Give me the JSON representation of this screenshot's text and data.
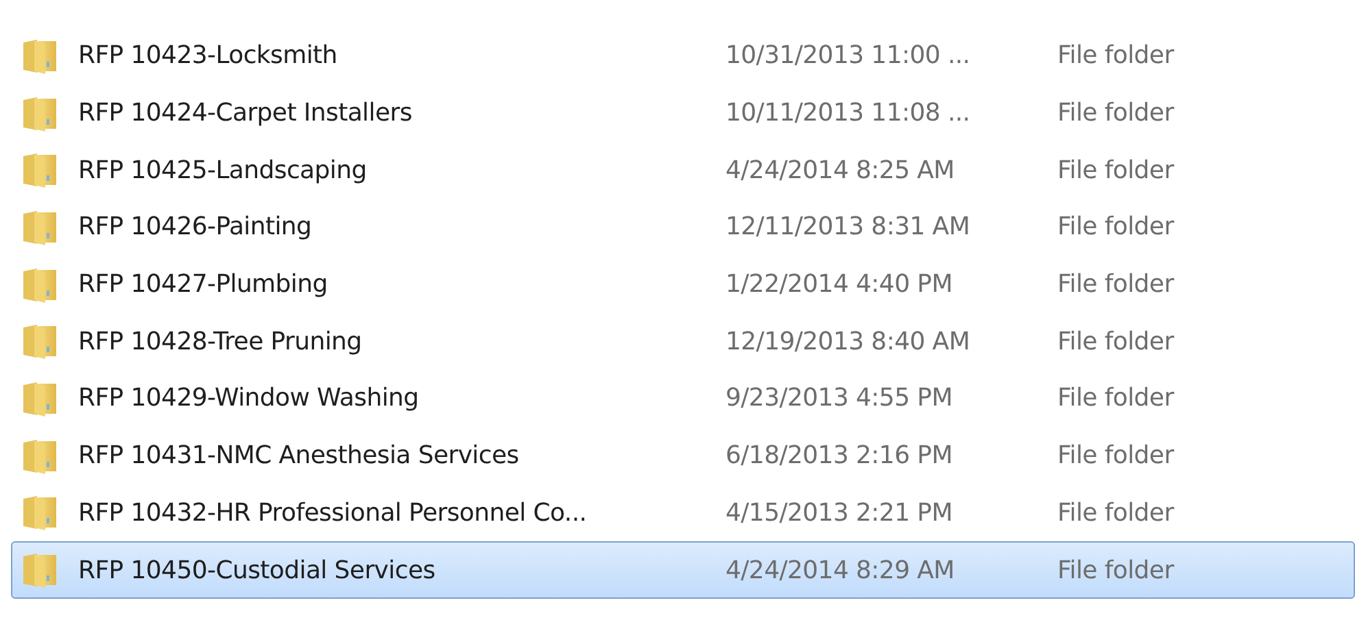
{
  "files": [
    {
      "name": "RFP 10423-Locksmith",
      "date": "10/31/2013 11:00 ...",
      "type": "File folder",
      "selected": false
    },
    {
      "name": "RFP 10424-Carpet Installers",
      "date": "10/11/2013 11:08 ...",
      "type": "File folder",
      "selected": false
    },
    {
      "name": "RFP 10425-Landscaping",
      "date": "4/24/2014 8:25 AM",
      "type": "File folder",
      "selected": false
    },
    {
      "name": "RFP 10426-Painting",
      "date": "12/11/2013 8:31 AM",
      "type": "File folder",
      "selected": false
    },
    {
      "name": "RFP 10427-Plumbing",
      "date": "1/22/2014 4:40 PM",
      "type": "File folder",
      "selected": false
    },
    {
      "name": "RFP 10428-Tree Pruning",
      "date": "12/19/2013 8:40 AM",
      "type": "File folder",
      "selected": false
    },
    {
      "name": "RFP 10429-Window Washing",
      "date": "9/23/2013 4:55 PM",
      "type": "File folder",
      "selected": false
    },
    {
      "name": "RFP 10431-NMC Anesthesia Services",
      "date": "6/18/2013 2:16 PM",
      "type": "File folder",
      "selected": false
    },
    {
      "name": "RFP 10432-HR Professional Personnel Co...",
      "date": "4/15/2013 2:21 PM",
      "type": "File folder",
      "selected": false
    },
    {
      "name": "RFP 10450-Custodial Services",
      "date": "4/24/2014 8:29 AM",
      "type": "File folder",
      "selected": true
    }
  ]
}
